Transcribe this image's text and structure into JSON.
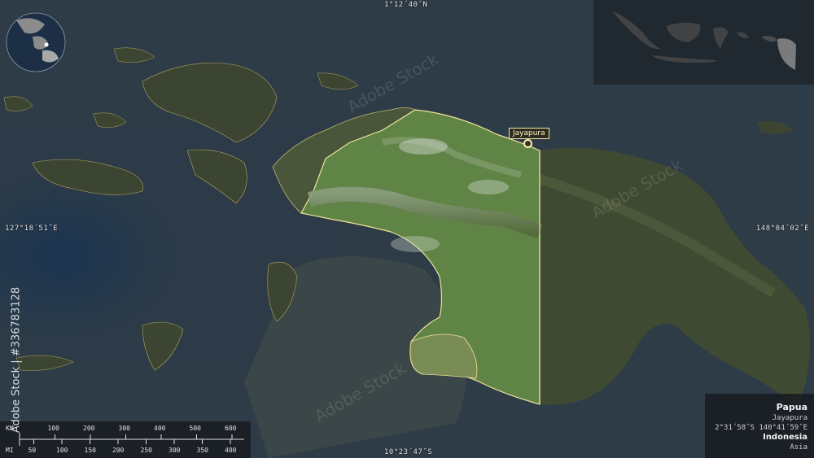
{
  "map": {
    "coords": {
      "top": "1°12´40˝N",
      "bottom": "10°23´47˝S",
      "left": "127°18´51˝E",
      "right": "148°04´02˝E"
    },
    "city": {
      "label": "Jayapura"
    },
    "info": {
      "region": "Papua",
      "capital": "Jayapura",
      "capital_coords": "2°31´58˝S 140°41´59˝E",
      "country": "Indonesia",
      "continent": "Asia"
    },
    "scale": {
      "km_unit": "KM",
      "km_ticks": [
        "100",
        "200",
        "300",
        "400",
        "500",
        "600"
      ],
      "mi_unit": "MI",
      "mi_ticks": [
        "50",
        "100",
        "150",
        "200",
        "250",
        "300",
        "350",
        "400"
      ]
    },
    "watermark": "Adobe Stock | #336783128",
    "colors": {
      "sea": "#2b3a46",
      "highlight": "#6f9a52",
      "border": "#f0e39a"
    }
  }
}
